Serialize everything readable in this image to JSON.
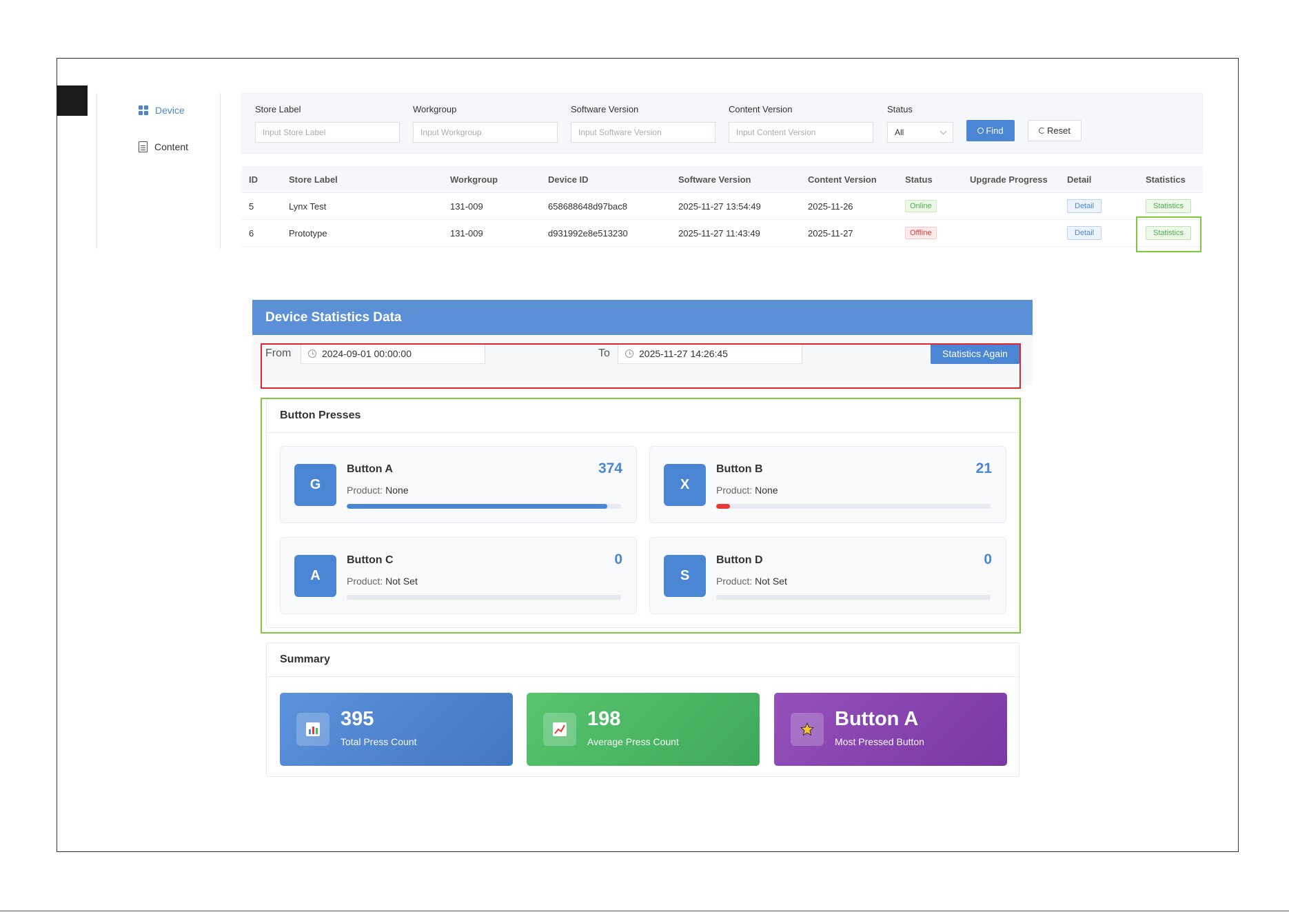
{
  "sidebar": {
    "items": [
      {
        "label": "Device",
        "icon": "grid-icon",
        "active": true
      },
      {
        "label": "Content",
        "icon": "document-icon",
        "active": false
      }
    ]
  },
  "filters": {
    "store_label": {
      "label": "Store Label",
      "placeholder": "Input Store Label"
    },
    "workgroup": {
      "label": "Workgroup",
      "placeholder": "Input Workgroup"
    },
    "software_version": {
      "label": "Software Version",
      "placeholder": "Input Software Version"
    },
    "content_version": {
      "label": "Content Version",
      "placeholder": "Input Content Version"
    },
    "status": {
      "label": "Status",
      "value": "All"
    },
    "find_label": "Find",
    "reset_label": "Reset"
  },
  "table": {
    "columns": [
      "ID",
      "Store Label",
      "Workgroup",
      "Device ID",
      "Software Version",
      "Content Version",
      "Status",
      "Upgrade Progress",
      "Detail",
      "Statistics"
    ],
    "rows": [
      {
        "id": "5",
        "store_label": "Lynx Test",
        "workgroup": "131-009",
        "device_id": "658688648d97bac8",
        "software_version": "2025-11-27 13:54:49",
        "content_version": "2025-11-26",
        "status": "Online",
        "upgrade_progress": "",
        "detail": "Detail",
        "statistics": "Statistics"
      },
      {
        "id": "6",
        "store_label": "Prototype",
        "workgroup": "131-009",
        "device_id": "d931992e8e513230",
        "software_version": "2025-11-27 11:43:49",
        "content_version": "2025-11-27",
        "status": "Offline",
        "upgrade_progress": "",
        "detail": "Detail",
        "statistics": "Statistics"
      }
    ]
  },
  "modal": {
    "title": "Device Statistics Data",
    "from_label": "From",
    "from_value": "2024-09-01 00:00:00",
    "to_label": "To",
    "to_value": "2025-11-27 14:26:45",
    "again_label": "Statistics Again"
  },
  "presses": {
    "title": "Button Presses",
    "product_label": "Product:",
    "items": [
      {
        "letter": "G",
        "name": "Button A",
        "product": "None",
        "count": "374",
        "fraction": 0.95,
        "bar_color": "#4a86d4"
      },
      {
        "letter": "X",
        "name": "Button B",
        "product": "None",
        "count": "21",
        "fraction": 0.05,
        "bar_color": "#e53935"
      },
      {
        "letter": "A",
        "name": "Button C",
        "product": "Not Set",
        "count": "0",
        "fraction": 0,
        "bar_color": "#4a86d4"
      },
      {
        "letter": "S",
        "name": "Button D",
        "product": "Not Set",
        "count": "0",
        "fraction": 0,
        "bar_color": "#4a86d4"
      }
    ]
  },
  "summary": {
    "title": "Summary",
    "total": {
      "value": "395",
      "caption": "Total Press Count",
      "icon": "bar-chart-icon"
    },
    "average": {
      "value": "198",
      "caption": "Average Press Count",
      "icon": "line-chart-icon"
    },
    "most": {
      "value": "Button A",
      "caption": "Most Pressed Button",
      "icon": "star-icon"
    }
  },
  "colors": {
    "accent": "#4a86d4",
    "online": "#4caf50",
    "offline": "#e53935",
    "summary_blue": "#4a86d4",
    "summary_green": "#4cbb64",
    "summary_purple": "#8a44b0",
    "highlight_red": "#e0262a",
    "highlight_green": "#7ec83a"
  }
}
